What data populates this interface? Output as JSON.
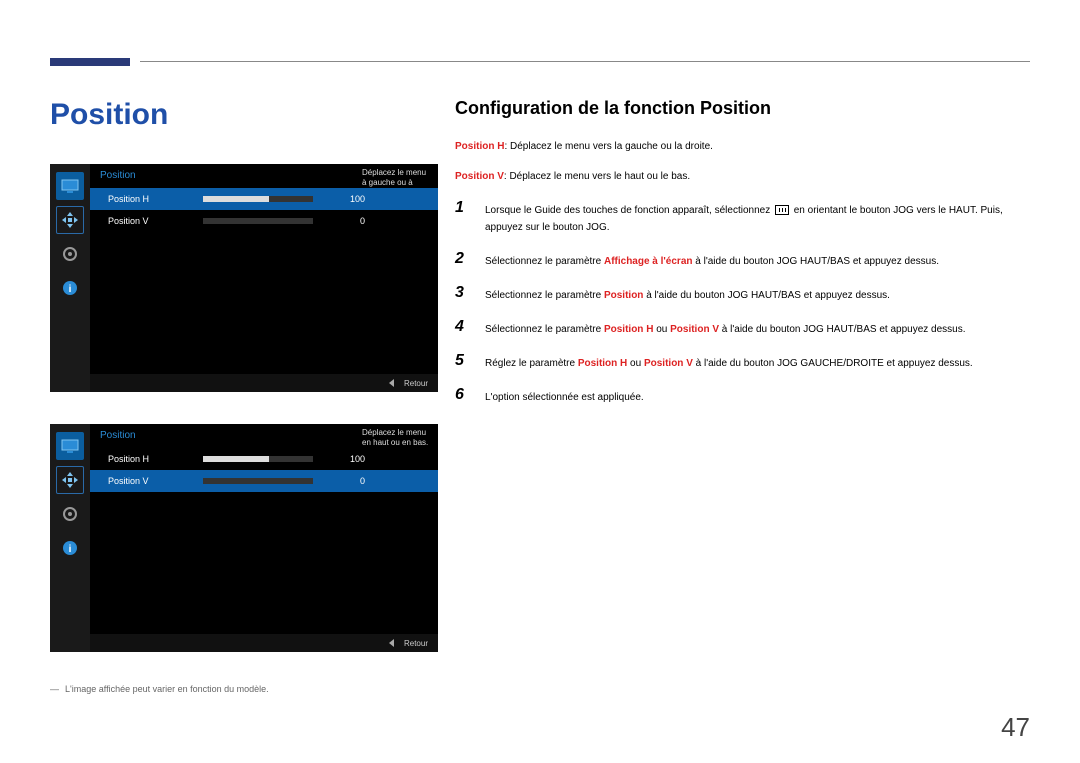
{
  "page": {
    "section_title": "Position",
    "heading": "Configuration de la fonction Position",
    "position_h_label": "Position H",
    "position_h_desc": ": Déplacez le menu vers la gauche ou la droite.",
    "position_v_label": "Position V",
    "position_v_desc": ": Déplacez le menu vers le haut ou le bas.",
    "page_number": "47",
    "footnote": "L'image affichée peut varier en fonction du modèle."
  },
  "steps": [
    {
      "num": "1",
      "pre": "Lorsque le Guide des touches de fonction apparaît, sélectionnez ",
      "post": " en orientant le bouton JOG vers le HAUT. Puis, appuyez sur le bouton JOG."
    },
    {
      "num": "2",
      "pre": "Sélectionnez le paramètre ",
      "bold": "Affichage à l'écran",
      "post": " à l'aide du bouton JOG HAUT/BAS et appuyez dessus."
    },
    {
      "num": "3",
      "pre": "Sélectionnez le paramètre ",
      "bold": "Position",
      "post": " à l'aide du bouton JOG HAUT/BAS et appuyez dessus."
    },
    {
      "num": "4",
      "pre": "Sélectionnez le paramètre ",
      "bold": "Position H",
      "mid": " ou ",
      "bold2": "Position V",
      "post": " à l'aide du bouton JOG HAUT/BAS et appuyez dessus."
    },
    {
      "num": "5",
      "pre": "Réglez le paramètre ",
      "bold": "Position H",
      "mid": " ou ",
      "bold2": "Position V",
      "post": " à l'aide du bouton JOG GAUCHE/DROITE et appuyez dessus."
    },
    {
      "num": "6",
      "pre": "L'option sélectionnée est appliquée."
    }
  ],
  "osd1": {
    "title": "Position",
    "tip": "Déplacez le menu à gauche ou à droite.",
    "rows": [
      {
        "label": "Position H",
        "value": "100",
        "fill_pct": 60,
        "selected": true
      },
      {
        "label": "Position V",
        "value": "0",
        "fill_pct": 0,
        "selected": false
      }
    ],
    "return": "Retour",
    "highlight": "move"
  },
  "osd2": {
    "title": "Position",
    "tip": "Déplacez le menu en haut ou en bas.",
    "rows": [
      {
        "label": "Position H",
        "value": "100",
        "fill_pct": 60,
        "selected": false
      },
      {
        "label": "Position V",
        "value": "0",
        "fill_pct": 0,
        "selected": true
      }
    ],
    "return": "Retour",
    "highlight": "move"
  }
}
